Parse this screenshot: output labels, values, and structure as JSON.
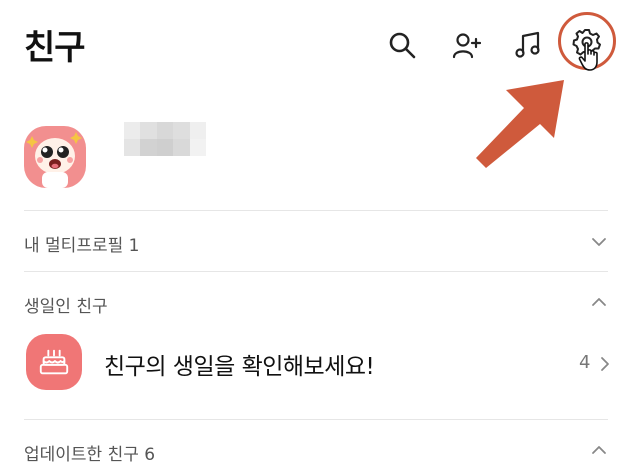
{
  "header": {
    "title": "친구",
    "icons": [
      "search-icon",
      "add-friend-icon",
      "music-icon",
      "settings-icon"
    ]
  },
  "profile": {
    "avatar_icon": "peach-character-avatar"
  },
  "sections": {
    "multiprofile_label": "내 멀티프로필 1",
    "birthday_label": "생일인 친구",
    "updated_label": "업데이트한 친구 6"
  },
  "birthday": {
    "text": "친구의 생일을 확인해보세요!",
    "count": "4"
  },
  "colors": {
    "annotation": "#cf5a3c",
    "avatar_bg": "#f28f8f",
    "birthday_icon_bg": "#f07676"
  }
}
